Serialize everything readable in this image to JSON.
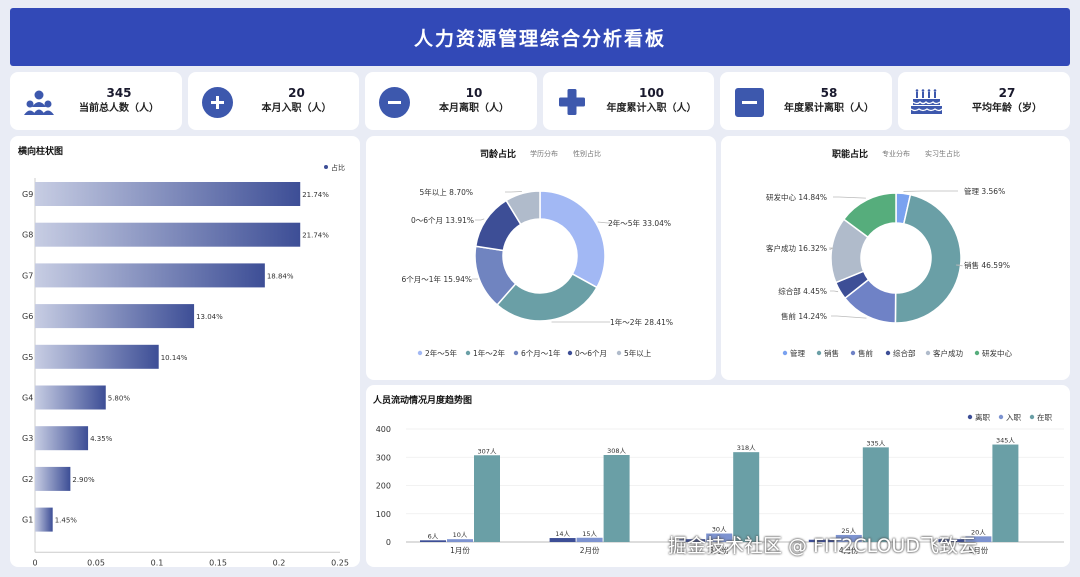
{
  "header": {
    "title": "人力资源管理综合分析看板"
  },
  "kpis": [
    {
      "value": "345",
      "label": "当前总人数（人）",
      "icon": "people-icon"
    },
    {
      "value": "20",
      "label": "本月入职（人）",
      "icon": "plus-circle-icon"
    },
    {
      "value": "10",
      "label": "本月离职（人）",
      "icon": "minus-circle-icon"
    },
    {
      "value": "100",
      "label": "年度累计入职（人）",
      "icon": "plus-cross-icon"
    },
    {
      "value": "58",
      "label": "年度累计离职（人）",
      "icon": "minus-square-icon"
    },
    {
      "value": "27",
      "label": "平均年龄（岁）",
      "icon": "cake-icon"
    }
  ],
  "colors": {
    "header": "#3249b7",
    "accent": "#3d58ad",
    "teal": "#6a9fa6"
  },
  "hbar": {
    "title": "横向柱状图",
    "legend": "占比",
    "chart_data": {
      "type": "bar",
      "orientation": "horizontal",
      "categories": [
        "G9",
        "G8",
        "G7",
        "G6",
        "G5",
        "G4",
        "G3",
        "G2",
        "G1"
      ],
      "values": [
        0.2174,
        0.2174,
        0.1884,
        0.1304,
        0.1014,
        0.058,
        0.0435,
        0.029,
        0.0145
      ],
      "value_labels": [
        "21.74%",
        "21.74%",
        "18.84%",
        "13.04%",
        "10.14%",
        "5.80%",
        "4.35%",
        "2.90%",
        "1.45%"
      ],
      "xticks": [
        "0",
        "0.05",
        "0.1",
        "0.15",
        "0.2",
        "0.25"
      ],
      "xlim": [
        0,
        0.25
      ]
    }
  },
  "tenure": {
    "title": "司龄占比",
    "tabs": [
      "学历分布",
      "性别占比"
    ],
    "chart_data": {
      "type": "pie",
      "labels": [
        "2年～5年",
        "1年～2年",
        "6个月～1年",
        "0～6个月",
        "5年以上"
      ],
      "values": [
        33.04,
        28.41,
        15.94,
        13.91,
        8.7
      ],
      "slice_labels": [
        "2年～5年 33.04%",
        "1年～2年 28.41%",
        "6个月～1年 15.94%",
        "0～6个月 13.91%",
        "5年以上 8.70%"
      ],
      "colors": [
        "#a2b8f4",
        "#6a9fa6",
        "#7084c0",
        "#3d4e96",
        "#b0bbcb"
      ]
    }
  },
  "func": {
    "title": "职能占比",
    "tabs": [
      "专业分布",
      "实习生占比"
    ],
    "chart_data": {
      "type": "pie",
      "labels": [
        "管理",
        "销售",
        "售前",
        "综合部",
        "客户成功",
        "研发中心"
      ],
      "values": [
        3.56,
        46.59,
        14.24,
        4.45,
        16.32,
        14.84
      ],
      "slice_labels": [
        "管理 3.56%",
        "销售 46.59%",
        "售前 14.24%",
        "综合部 4.45%",
        "客户成功 16.32%",
        "研发中心 14.84%"
      ],
      "colors": [
        "#7aa2f0",
        "#6a9fa6",
        "#6f82c6",
        "#3d4e96",
        "#b0bbcb",
        "#56ad7c"
      ]
    }
  },
  "trend": {
    "title": "人员流动情况月度趋势图",
    "legend": [
      "离职",
      "入职",
      "在职"
    ],
    "chart_data": {
      "type": "bar",
      "categories": [
        "1月份",
        "2月份",
        "3月份",
        "4月份",
        "5月份"
      ],
      "series": [
        {
          "name": "离职",
          "values": [
            6,
            14,
            10,
            8,
            10
          ],
          "labels": [
            "6人",
            "14人",
            "",
            "",
            ""
          ],
          "color": "#3d4e96"
        },
        {
          "name": "入职",
          "values": [
            10,
            15,
            30,
            25,
            20
          ],
          "labels": [
            "10人",
            "15人",
            "30人",
            "25人",
            "20人"
          ],
          "color": "#7d93d0"
        },
        {
          "name": "在职",
          "values": [
            307,
            308,
            318,
            335,
            345
          ],
          "labels": [
            "307人",
            "308人",
            "318人",
            "335人",
            "345人"
          ],
          "color": "#6a9fa6"
        }
      ],
      "yticks": [
        "0",
        "100",
        "200",
        "300",
        "400"
      ],
      "ylim": [
        0,
        400
      ]
    }
  },
  "watermark": "掘金技术社区 @ FIT2CLOUD飞致云"
}
